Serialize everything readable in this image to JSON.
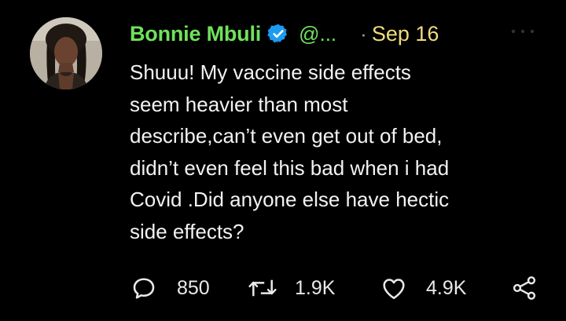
{
  "author": {
    "display_name": "Bonnie Mbuli",
    "handle": "@...",
    "verified": true,
    "name_color": "#6fe25a"
  },
  "timestamp": {
    "separator": "·",
    "date": "Sep 16",
    "color": "#f1dc7a"
  },
  "tweet": {
    "lines": [
      "Shuuu! My vaccine side effects",
      "seem heavier than most",
      "describe,can’t even get out of bed,",
      "didn’t even feel this bad when i had",
      "Covid .Did anyone else have hectic",
      "side effects?"
    ]
  },
  "actions": {
    "reply": {
      "icon": "reply-icon",
      "count": "850"
    },
    "retweet": {
      "icon": "retweet-icon",
      "count": "1.9K"
    },
    "like": {
      "icon": "heart-icon",
      "count": "4.9K"
    },
    "share": {
      "icon": "share-icon"
    }
  },
  "menu": {
    "icon": "more-icon"
  },
  "colors": {
    "background": "#000000",
    "verified_badge": "#1d9bf0",
    "text": "#f2f2f2",
    "muted": "#9aa0a6"
  }
}
